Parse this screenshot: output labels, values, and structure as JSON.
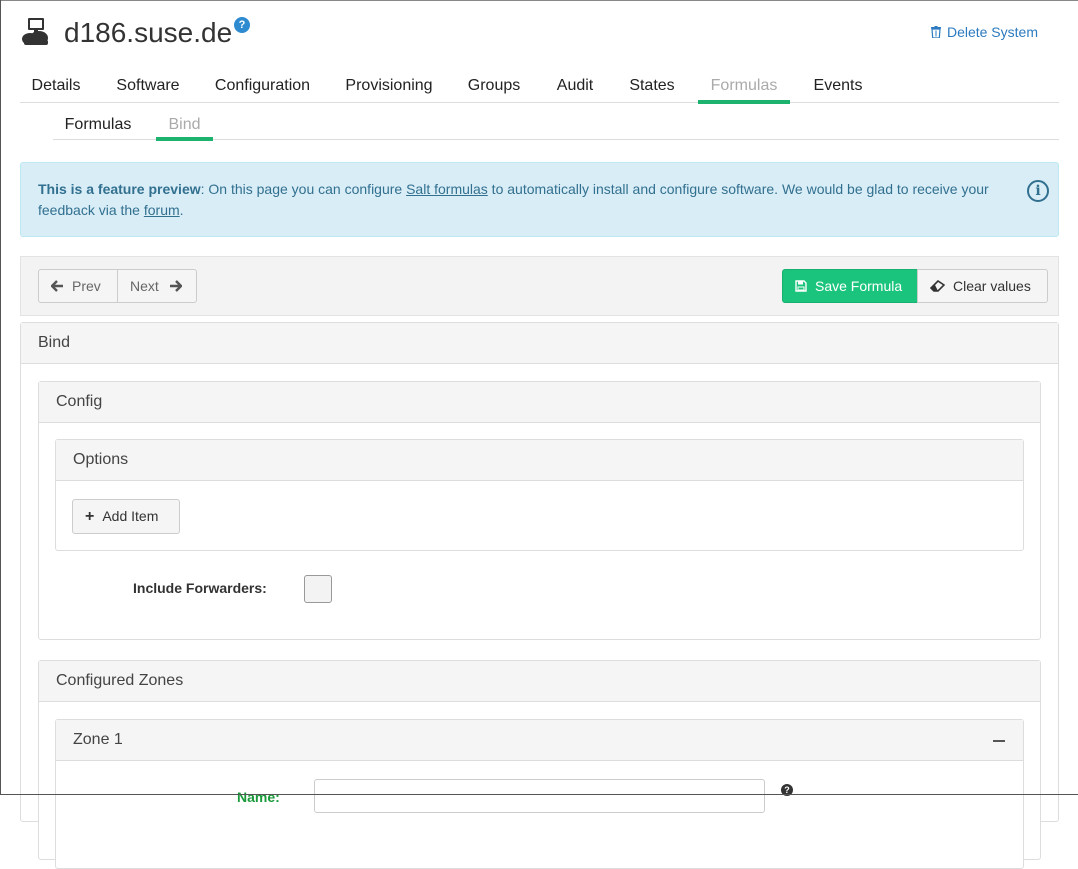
{
  "header": {
    "title": "d186.suse.de",
    "help_icon": "question-circle-icon",
    "delete_label": "Delete System"
  },
  "tabs": [
    {
      "label": "Details"
    },
    {
      "label": "Software"
    },
    {
      "label": "Configuration"
    },
    {
      "label": "Provisioning"
    },
    {
      "label": "Groups"
    },
    {
      "label": "Audit"
    },
    {
      "label": "States"
    },
    {
      "label": "Formulas",
      "active": true
    },
    {
      "label": "Events"
    }
  ],
  "subtabs": [
    {
      "label": "Formulas"
    },
    {
      "label": "Bind",
      "active": true
    }
  ],
  "info": {
    "bold": "This is a feature preview",
    "text1": ": On this page you can configure ",
    "link1": "Salt formulas",
    "text2": " to automatically install and configure software. We would be glad to receive your feedback via the ",
    "link2": "forum",
    "text3": "."
  },
  "toolbar": {
    "prev": "Prev",
    "next": "Next",
    "save": "Save Formula",
    "clear": "Clear values"
  },
  "panels": {
    "bind": "Bind",
    "config": "Config",
    "options": "Options",
    "add_item": "Add Item",
    "include_forwarders": "Include Forwarders:",
    "configured_zones": "Configured Zones",
    "zone1": "Zone 1",
    "name_label": "Name:"
  },
  "colors": {
    "accent": "#1bb36e",
    "info_bg": "#d9edf7",
    "info_text": "#31708f",
    "link": "#2c7bbf"
  }
}
